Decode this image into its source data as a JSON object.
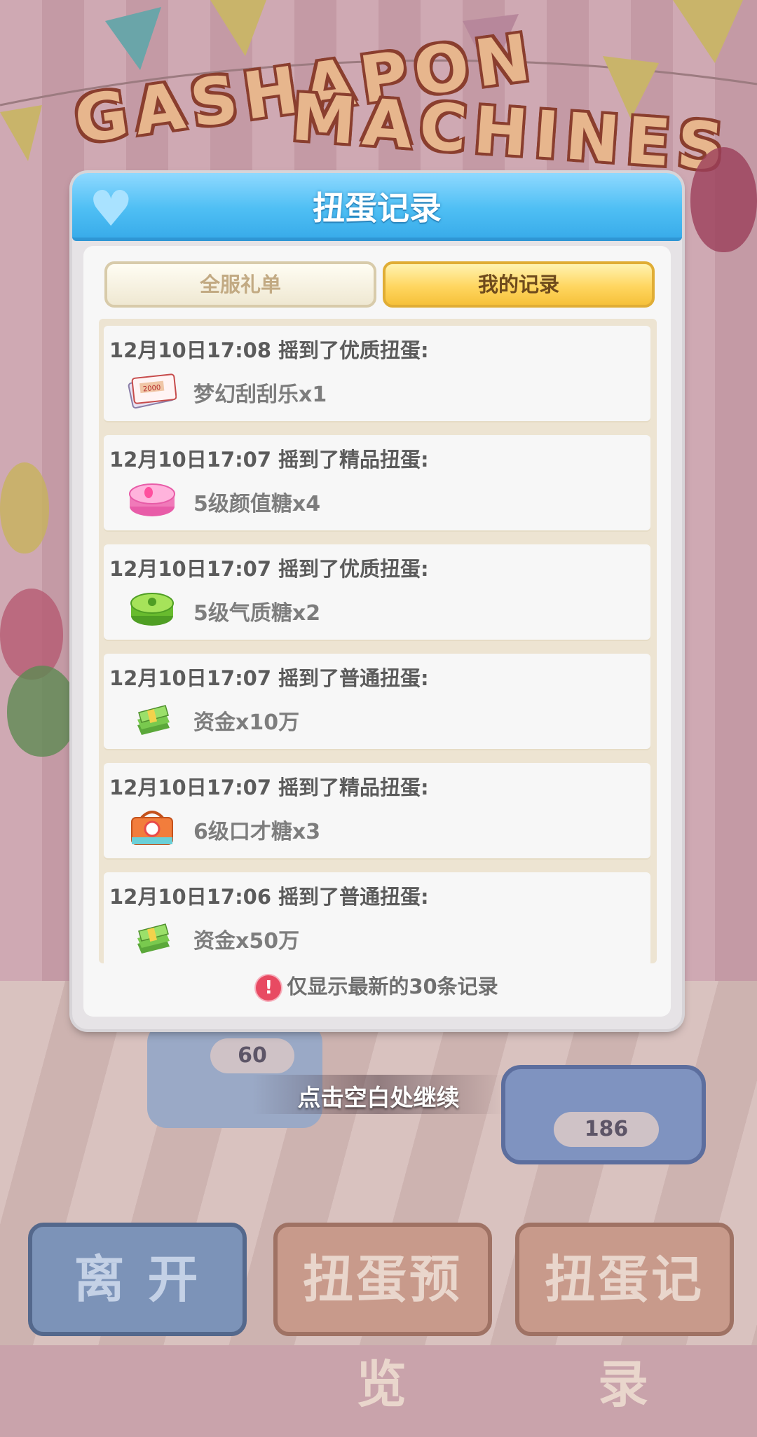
{
  "background": {
    "title_line1": "GASHAPON",
    "title_line2": "MACHINES",
    "counter_left": "60",
    "counter_right": "186",
    "bottom_buttons": [
      "离  开",
      "扭蛋预览",
      "扭蛋记录"
    ]
  },
  "modal": {
    "title": "扭蛋记录",
    "tabs": [
      {
        "label": "全服礼单",
        "active": false
      },
      {
        "label": "我的记录",
        "active": true
      }
    ],
    "records": [
      {
        "time": "12月10日17:08",
        "action": "摇到了优质扭蛋:",
        "item": "梦幻刮刮乐x1",
        "icon": "scratch-ticket-icon"
      },
      {
        "time": "12月10日17:07",
        "action": "摇到了精品扭蛋:",
        "item": "5级颜值糖x4",
        "icon": "pink-candy-tin-icon"
      },
      {
        "time": "12月10日17:07",
        "action": "摇到了优质扭蛋:",
        "item": "5级气质糖x2",
        "icon": "green-candy-tin-icon"
      },
      {
        "time": "12月10日17:07",
        "action": "摇到了普通扭蛋:",
        "item": "资金x10万",
        "icon": "money-stack-icon"
      },
      {
        "time": "12月10日17:07",
        "action": "摇到了精品扭蛋:",
        "item": "6级口才糖x3",
        "icon": "orange-gift-box-icon"
      },
      {
        "time": "12月10日17:06",
        "action": "摇到了普通扭蛋:",
        "item": "资金x50万",
        "icon": "money-stack-icon"
      }
    ],
    "note": "仅显示最新的30条记录",
    "note_icon": "!"
  },
  "continue_hint": "点击空白处继续",
  "colors": {
    "header_blue": "#4fbff4",
    "tab_active_gold": "#ffd660",
    "warn_red": "#e84a62"
  }
}
